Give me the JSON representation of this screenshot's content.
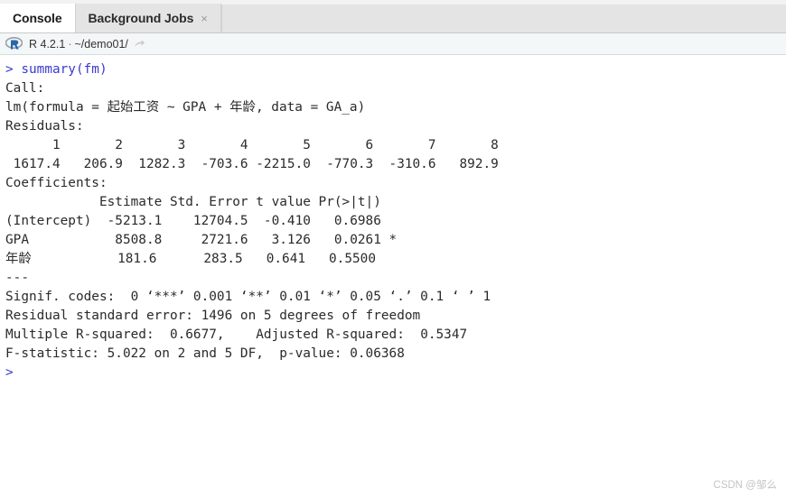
{
  "tabs": [
    {
      "label": "Console",
      "active": true,
      "closable": false
    },
    {
      "label": "Background Jobs",
      "active": false,
      "closable": true,
      "close_glyph": "×"
    }
  ],
  "session": {
    "logo_letter": "R",
    "version": "R 4.2.1",
    "separator": "·",
    "path": "~/demo01/"
  },
  "console": {
    "command_line": "> summary(fm)",
    "prompt": ">",
    "lines": [
      {
        "text": "> summary(fm)",
        "type": "command"
      },
      {
        "text": "",
        "type": "blank"
      },
      {
        "text": "Call:",
        "type": "output"
      },
      {
        "text": "lm(formula = 起始工资 ~ GPA + 年龄, data = GA_a)",
        "type": "output"
      },
      {
        "text": "",
        "type": "blank"
      },
      {
        "text": "Residuals:",
        "type": "output"
      },
      {
        "text": "      1       2       3       4       5       6       7       8 ",
        "type": "output"
      },
      {
        "text": " 1617.4   206.9  1282.3  -703.6 -2215.0  -770.3  -310.6   892.9 ",
        "type": "output"
      },
      {
        "text": "",
        "type": "blank"
      },
      {
        "text": "Coefficients:",
        "type": "output"
      },
      {
        "text": "            Estimate Std. Error t value Pr(>|t|)  ",
        "type": "output"
      },
      {
        "text": "(Intercept)  -5213.1    12704.5  -0.410   0.6986  ",
        "type": "output"
      },
      {
        "text": "GPA           8508.8     2721.6   3.126   0.0261 *",
        "type": "output"
      },
      {
        "text": "年龄           181.6      283.5   0.641   0.5500  ",
        "type": "output"
      },
      {
        "text": "---",
        "type": "output"
      },
      {
        "text": "Signif. codes:  0 ‘***’ 0.001 ‘**’ 0.01 ‘*’ 0.05 ‘.’ 0.1 ‘ ’ 1",
        "type": "output"
      },
      {
        "text": "",
        "type": "blank"
      },
      {
        "text": "Residual standard error: 1496 on 5 degrees of freedom",
        "type": "output"
      },
      {
        "text": "Multiple R-squared:  0.6677,\tAdjusted R-squared:  0.5347 ",
        "type": "output"
      },
      {
        "text": "F-statistic: 5.022 on 2 and 5 DF,  p-value: 0.06368",
        "type": "output"
      },
      {
        "text": "",
        "type": "blank"
      },
      {
        "text": ">",
        "type": "prompt"
      }
    ]
  },
  "model_summary": {
    "call": "lm(formula = 起始工资 ~ GPA + 年龄, data = GA_a)",
    "response": "起始工资",
    "predictors": [
      "GPA",
      "年龄"
    ],
    "data": "GA_a",
    "residuals": {
      "ids": [
        "1",
        "2",
        "3",
        "4",
        "5",
        "6",
        "7",
        "8"
      ],
      "values": [
        "1617.4",
        "206.9",
        "1282.3",
        "-703.6",
        "-2215.0",
        "-770.3",
        "-310.6",
        "892.9"
      ]
    },
    "coefficients": {
      "headers": [
        "",
        "Estimate",
        "Std. Error",
        "t value",
        "Pr(>|t|)",
        ""
      ],
      "rows": [
        {
          "term": "(Intercept)",
          "estimate": "-5213.1",
          "std_error": "12704.5",
          "t_value": "-0.410",
          "p_value": "0.6986",
          "signif": ""
        },
        {
          "term": "GPA",
          "estimate": "8508.8",
          "std_error": "2721.6",
          "t_value": "3.126",
          "p_value": "0.0261",
          "signif": "*"
        },
        {
          "term": "年龄",
          "estimate": "181.6",
          "std_error": "283.5",
          "t_value": "0.641",
          "p_value": "0.5500",
          "signif": ""
        }
      ]
    },
    "signif_codes": "Signif. codes:  0 ‘***’ 0.001 ‘**’ 0.01 ‘*’ 0.05 ‘.’ 0.1 ‘ ’ 1",
    "residual_standard_error": "1496",
    "residual_df": "5",
    "multiple_r_squared": "0.6677",
    "adjusted_r_squared": "0.5347",
    "f_statistic": "5.022",
    "f_df1": "2",
    "f_df2": "5",
    "p_value": "0.06368"
  },
  "watermark": "CSDN @邹么",
  "colors": {
    "command_blue": "#3a3ad0",
    "output_text": "#2a2a2a",
    "tab_active_bg": "#ffffff",
    "tab_inactive_bg": "#e4e4e4",
    "session_bar_bg": "#f3f7f8",
    "r_logo_blue": "#2767ab"
  }
}
